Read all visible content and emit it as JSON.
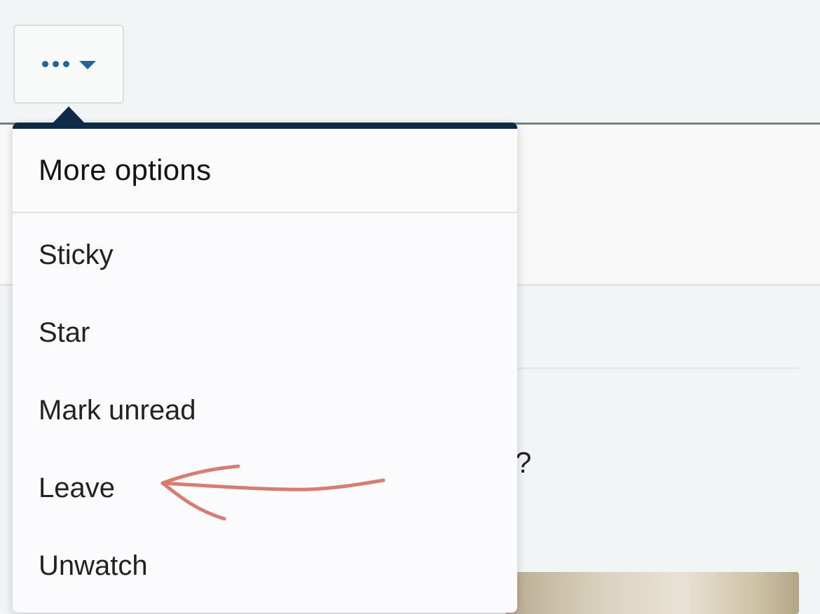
{
  "toolbar": {
    "more_button_icon": "ellipsis-icon",
    "more_button_caret": "caret-down-icon",
    "accent_color": "#236596"
  },
  "menu": {
    "title": "More options",
    "header_color": "#0d2a47",
    "items": [
      {
        "label": "Sticky"
      },
      {
        "label": "Star"
      },
      {
        "label": "Mark unread"
      },
      {
        "label": "Leave"
      },
      {
        "label": "Unwatch"
      }
    ]
  },
  "background": {
    "question_mark": "?"
  },
  "annotation": {
    "type": "hand-drawn-arrow",
    "color": "#d5766a",
    "points_to": "Leave"
  }
}
